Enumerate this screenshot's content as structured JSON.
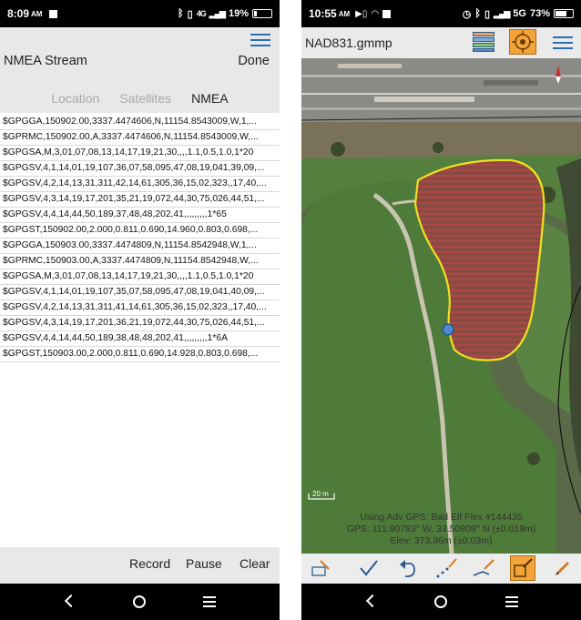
{
  "left_screen": {
    "status_bar": {
      "time": "8:09",
      "ampm": "AM",
      "network": "4G",
      "battery": "19%",
      "battery_level": 0.19
    },
    "header": {
      "title": "NMEA Stream",
      "done_label": "Done"
    },
    "tabs": [
      {
        "label": "Location",
        "active": false
      },
      {
        "label": "Satellites",
        "active": false
      },
      {
        "label": "NMEA",
        "active": true
      }
    ],
    "nmea_lines": [
      "$GPGGA,150902.00,3337.4474606,N,11154.8543009,W,1,...",
      "$GPRMC,150902.00,A,3337.4474606,N,11154.8543009,W,...",
      "$GPGSA,M,3,01,07,08,13,14,17,19,21,30,,,,1.1,0.5,1.0,1*20",
      "$GPGSV,4,1,14,01,19,107,36,07,58,095,47,08,19,041,39,09,...",
      "$GPGSV,4,2,14,13,31,311,42,14,61,305,36,15,02,323,,17,40,...",
      "$GPGSV,4,3,14,19,17,201,35,21,19,072,44,30,75,026,44,51,...",
      "$GPGSV,4,4,14,44,50,189,37,48,48,202,41,,,,,,,,,1*65",
      "$GPGST,150902.00,2.000,0.811,0.690,14.960,0.803,0.698,...",
      "$GPGGA,150903.00,3337.4474809,N,11154.8542948,W,1,...",
      "$GPRMC,150903.00,A,3337.4474809,N,11154.8542948,W,...",
      "$GPGSA,M,3,01,07,08,13,14,17,19,21,30,,,,1.1,0.5,1.0,1*20",
      "$GPGSV,4,1,14,01,19,107,35,07,58,095,47,08,19,041,40,09,...",
      "$GPGSV,4,2,14,13,31,311,41,14,61,305,36,15,02,323,,17,40,...",
      "$GPGSV,4,3,14,19,17,201,36,21,19,072,44,30,75,026,44,51,...",
      "$GPGSV,4,4,14,44,50,189,38,48,48,202,41,,,,,,,,,1*6A",
      "$GPGST,150903.00,2.000,0.811,0.690,14.928,0.803,0.698,..."
    ],
    "bottom_bar": {
      "record_label": "Record",
      "pause_label": "Pause",
      "clear_label": "Clear"
    }
  },
  "right_screen": {
    "status_bar": {
      "time": "10:55",
      "ampm": "AM",
      "network": "5G",
      "battery": "73%",
      "battery_level": 0.73
    },
    "header": {
      "title": "NAD831.gmmp"
    },
    "map": {
      "scale_label": "20 m",
      "gps_source": "Using Adv GPS: Bad Elf Flex #144435",
      "gps_position": "GPS:  111.90783° W, 33.50809° N (±0.019m)",
      "elevation": "Elev: 373.96m (±0.03m)",
      "polygon_fill": "#8a4a44",
      "polygon_outline": "#f0e020"
    },
    "toolbar": [
      "toolbox-icon",
      "checkmark-icon",
      "undo-icon",
      "point-stream-icon",
      "line-tool-icon",
      "polygon-tool-icon",
      "pencil-icon"
    ]
  }
}
